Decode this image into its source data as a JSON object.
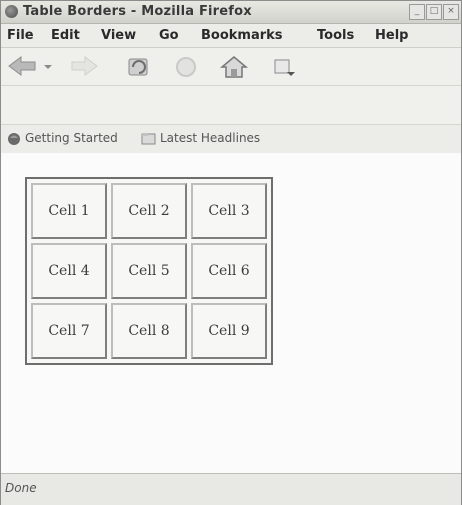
{
  "window": {
    "title": "Table Borders - Mozilla Firefox"
  },
  "menu": {
    "items": [
      "File",
      "Edit",
      "View",
      "Go",
      "Bookmarks",
      "Tools",
      "Help"
    ]
  },
  "toolbar": {
    "buttons": [
      "back-icon",
      "forward-icon",
      "reload-icon",
      "stop-icon",
      "home-icon",
      "go-icon"
    ]
  },
  "bookmarks": {
    "items": [
      {
        "label": "Getting Started",
        "icon": "firefox-icon"
      },
      {
        "label": "Latest Headlines",
        "icon": "rss-folder-icon"
      }
    ]
  },
  "table": {
    "rows": [
      [
        "Cell 1",
        "Cell 2",
        "Cell 3"
      ],
      [
        "Cell 4",
        "Cell 5",
        "Cell 6"
      ],
      [
        "Cell 7",
        "Cell 8",
        "Cell 9"
      ]
    ]
  },
  "status": {
    "text": "Done"
  }
}
